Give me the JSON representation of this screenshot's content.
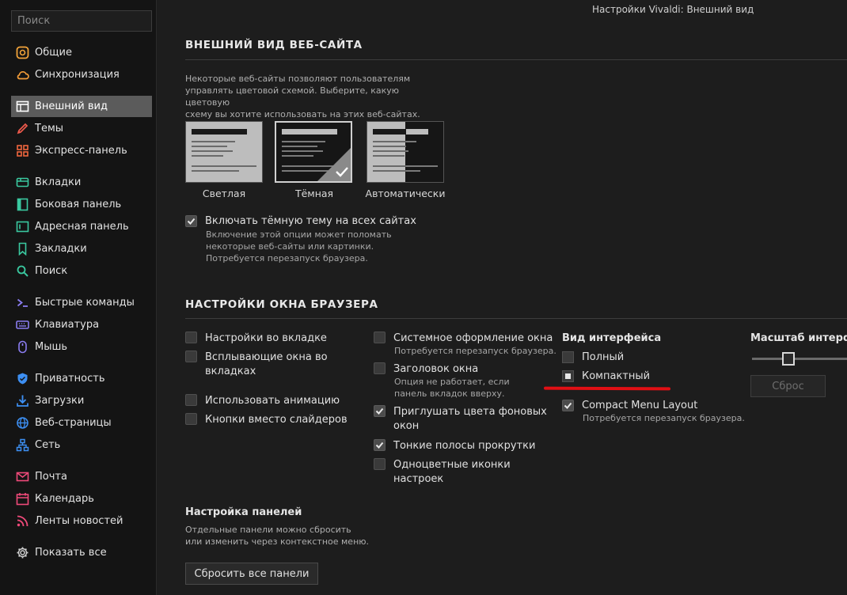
{
  "sidebar": {
    "search_placeholder": "Поиск",
    "items": [
      {
        "label": "Общие",
        "icon": "general-icon",
        "color": "#f2a33a"
      },
      {
        "label": "Синхронизация",
        "icon": "cloud-icon",
        "color": "#f29c38"
      },
      {
        "label": "Внешний вид",
        "icon": "appearance-icon",
        "color": "#ffffff",
        "active": true
      },
      {
        "label": "Темы",
        "icon": "themes-icon",
        "color": "#ef5a4c"
      },
      {
        "label": "Экспресс-панель",
        "icon": "speed-dial-icon",
        "color": "#f0663e"
      },
      {
        "label": "Вкладки",
        "icon": "tabs-icon",
        "color": "#3ac9a0"
      },
      {
        "label": "Боковая панель",
        "icon": "panel-icon",
        "color": "#3ac9a0"
      },
      {
        "label": "Адресная панель",
        "icon": "address-bar-icon",
        "color": "#3ac9a0"
      },
      {
        "label": "Закладки",
        "icon": "bookmark-icon",
        "color": "#3ac9a0"
      },
      {
        "label": "Поиск",
        "icon": "search-icon",
        "color": "#3ac9a0"
      },
      {
        "label": "Быстрые команды",
        "icon": "quick-commands-icon",
        "color": "#8a7cf0"
      },
      {
        "label": "Клавиатура",
        "icon": "keyboard-icon",
        "color": "#8a7cf0"
      },
      {
        "label": "Мышь",
        "icon": "mouse-icon",
        "color": "#8a7cf0"
      },
      {
        "label": "Приватность",
        "icon": "shield-icon",
        "color": "#3d8ff2"
      },
      {
        "label": "Загрузки",
        "icon": "download-icon",
        "color": "#3d8ff2"
      },
      {
        "label": "Веб-страницы",
        "icon": "globe-icon",
        "color": "#3d8ff2"
      },
      {
        "label": "Сеть",
        "icon": "network-icon",
        "color": "#3d8ff2"
      },
      {
        "label": "Почта",
        "icon": "mail-icon",
        "color": "#ef4a7a"
      },
      {
        "label": "Календарь",
        "icon": "calendar-icon",
        "color": "#ef4a7a"
      },
      {
        "label": "Ленты новостей",
        "icon": "feed-icon",
        "color": "#ef4a7a"
      },
      {
        "label": "Показать все",
        "icon": "gear-icon",
        "color": "#cfcfcf"
      }
    ]
  },
  "header": {
    "title": "Настройки Vivaldi: Внешний вид"
  },
  "website_appearance": {
    "title": "ВНЕШНИЙ ВИД ВЕБ-САЙТА",
    "description": [
      "Некоторые веб-сайты позволяют пользователям",
      "управлять цветовой схемой. Выберите, какую цветовую",
      "схему вы хотите использовать на этих веб-сайтах."
    ],
    "themes": [
      {
        "label": "Светлая",
        "selected": false
      },
      {
        "label": "Тёмная",
        "selected": true
      },
      {
        "label": "Автоматически",
        "selected": false
      }
    ],
    "dark_all": {
      "label": "Включать тёмную тему на всех сайтах",
      "checked": true,
      "note": [
        "Включение этой опции может поломать",
        "некоторые веб-сайты или картинки.",
        "Потребуется перезапуск браузера."
      ]
    }
  },
  "browser_window": {
    "title": "НАСТРОЙКИ ОКНА БРАУЗЕРА",
    "col1": [
      {
        "label": "Настройки во вкладке",
        "checked": false
      },
      {
        "label": [
          "Всплывающие окна во",
          "вкладках"
        ],
        "checked": false
      },
      {
        "label": "Использовать анимацию",
        "checked": false
      },
      {
        "label": "Кнопки вместо слайдеров",
        "checked": false
      }
    ],
    "col2": [
      {
        "label": "Системное оформление окна",
        "checked": false,
        "note": "Потребуется перезапуск браузера."
      },
      {
        "label": "Заголовок окна",
        "checked": false,
        "note": [
          "Опция не работает, если",
          "панель вкладок вверху."
        ]
      },
      {
        "label": [
          "Приглушать цвета фоновых",
          "окон"
        ],
        "checked": true
      },
      {
        "label": "Тонкие полосы прокрутки",
        "checked": true
      },
      {
        "label": [
          "Одноцветные иконки",
          "настроек"
        ],
        "checked": false
      }
    ],
    "interface_view": {
      "title": "Вид интерфейса",
      "options": [
        {
          "label": "Полный",
          "selected": false
        },
        {
          "label": "Компактный",
          "selected": true
        }
      ],
      "compact_menu": {
        "label": "Compact Menu Layout",
        "checked": true,
        "note": "Потребуется перезапуск браузера."
      }
    },
    "zoom": {
      "title": "Масштаб интерфейса",
      "reset_label": "Сброс",
      "level": 0.35
    },
    "panels": {
      "title": "Настройка панелей",
      "description": [
        "Отдельные панели можно сбросить",
        "или изменить через контекстное меню."
      ],
      "reset_label": "Сбросить все панели"
    }
  },
  "colors": {
    "accent_underline": "#e10f14",
    "active_nav": "#5b5b5b"
  }
}
